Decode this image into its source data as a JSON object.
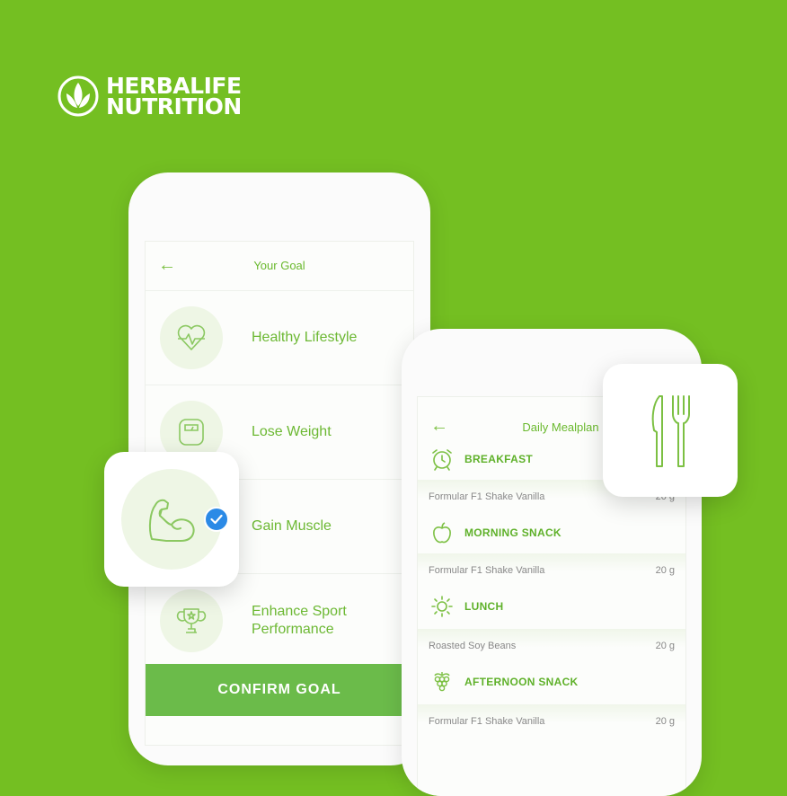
{
  "brand": {
    "line1": "HERBALIFE",
    "line2": "NUTRITION"
  },
  "goal_screen": {
    "title": "Your Goal",
    "back_icon": "arrow-left-icon",
    "goals": [
      {
        "label": "Healthy Lifestyle",
        "icon": "heart-pulse-icon"
      },
      {
        "label": "Lose Weight",
        "icon": "scale-icon"
      },
      {
        "label": "Gain Muscle",
        "icon": "flexed-arm-icon",
        "selected": true
      },
      {
        "label": "Enhance Sport Performance",
        "icon": "trophy-icon"
      }
    ],
    "confirm_label": "CONFIRM GOAL"
  },
  "meal_screen": {
    "title": "Daily Mealplan",
    "back_icon": "arrow-left-icon",
    "meals": [
      {
        "name": "BREAKFAST",
        "icon": "alarm-clock-icon",
        "item": "Formular F1 Shake Vanilla",
        "qty": "20 g"
      },
      {
        "name": "MORNING SNACK",
        "icon": "apple-icon",
        "item": "Formular F1 Shake Vanilla",
        "qty": "20 g"
      },
      {
        "name": "LUNCH",
        "icon": "sun-icon",
        "item": "Roasted Soy Beans",
        "qty": "20 g"
      },
      {
        "name": "AFTERNOON SNACK",
        "icon": "grapes-icon",
        "item": "Formular F1 Shake Vanilla",
        "qty": "20 g"
      }
    ]
  },
  "colors": {
    "background": "#74bf22",
    "accent": "#6bbb4a",
    "check": "#2b8ae6"
  }
}
